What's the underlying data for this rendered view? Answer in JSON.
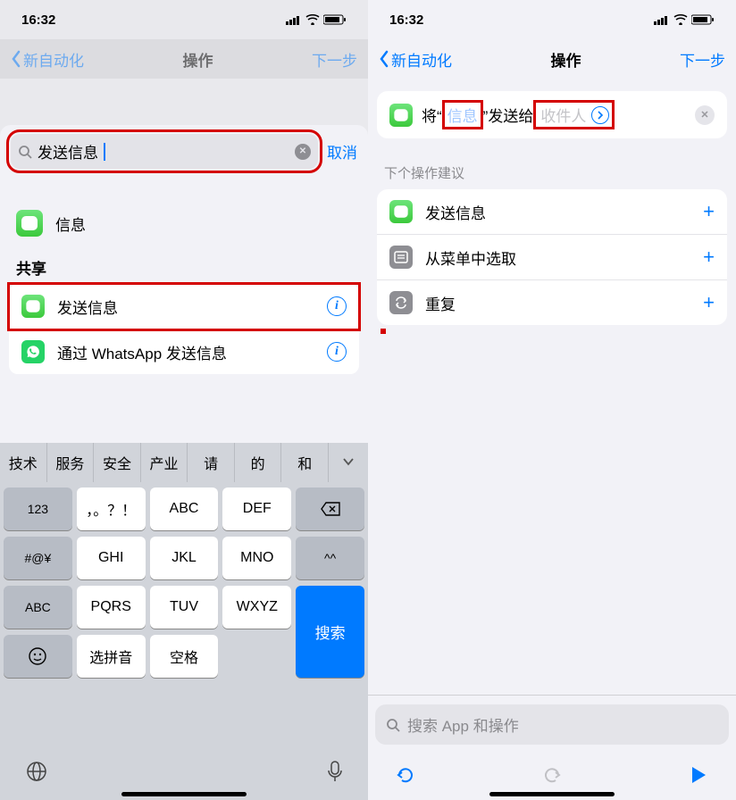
{
  "status": {
    "time": "16:32"
  },
  "nav": {
    "back": "新自动化",
    "title": "操作",
    "next": "下一步"
  },
  "left": {
    "search": {
      "value": "发送信息",
      "cancel": "取消"
    },
    "appRow": {
      "label": "信息"
    },
    "section": "共享",
    "items": [
      {
        "label": "发送信息",
        "icon": "messages"
      },
      {
        "label": "通过 WhatsApp 发送信息",
        "icon": "whatsapp"
      }
    ],
    "candidates": [
      "技术",
      "服务",
      "安全",
      "产业",
      "请",
      "的",
      "和"
    ],
    "keys": {
      "r1": [
        "123",
        "，。？！",
        "ABC",
        "DEF"
      ],
      "r2": [
        "#@¥",
        "GHI",
        "JKL",
        "MNO"
      ],
      "r3": [
        "ABC",
        "PQRS",
        "TUV",
        "WXYZ"
      ],
      "r4": [
        "选拼音",
        "空格"
      ],
      "caret": "^^",
      "search": "搜索"
    }
  },
  "right": {
    "action": {
      "prefix": "将“",
      "msg": "信息",
      "mid": "”发送给",
      "recipient": "收件人"
    },
    "suggHeader": "下个操作建议",
    "suggestions": [
      {
        "label": "发送信息",
        "icon": "messages"
      },
      {
        "label": "从菜单中选取",
        "icon": "menu"
      },
      {
        "label": "重复",
        "icon": "repeat"
      }
    ],
    "dockSearch": "搜索 App 和操作"
  }
}
